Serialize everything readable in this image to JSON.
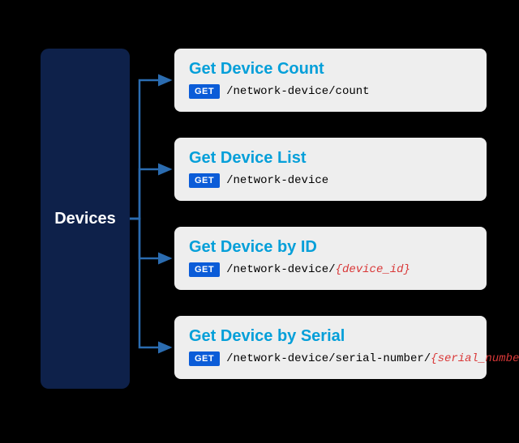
{
  "source": {
    "label": "Devices"
  },
  "endpoints": [
    {
      "title": "Get Device Count",
      "method": "GET",
      "path": "/network-device/count",
      "param": ""
    },
    {
      "title": "Get Device List",
      "method": "GET",
      "path": "/network-device",
      "param": ""
    },
    {
      "title": "Get Device by ID",
      "method": "GET",
      "path": "/network-device/",
      "param": "{device_id}"
    },
    {
      "title": "Get Device by Serial",
      "method": "GET",
      "path": "/network-device/serial-number/",
      "param": "{serial_number}"
    }
  ],
  "colors": {
    "background": "#000000",
    "sourceBox": "#0e214a",
    "cardBg": "#eeeeee",
    "title": "#049fd9",
    "methodBadge": "#0b5cd8",
    "param": "#d93838",
    "arrow": "#2b6cb0"
  }
}
